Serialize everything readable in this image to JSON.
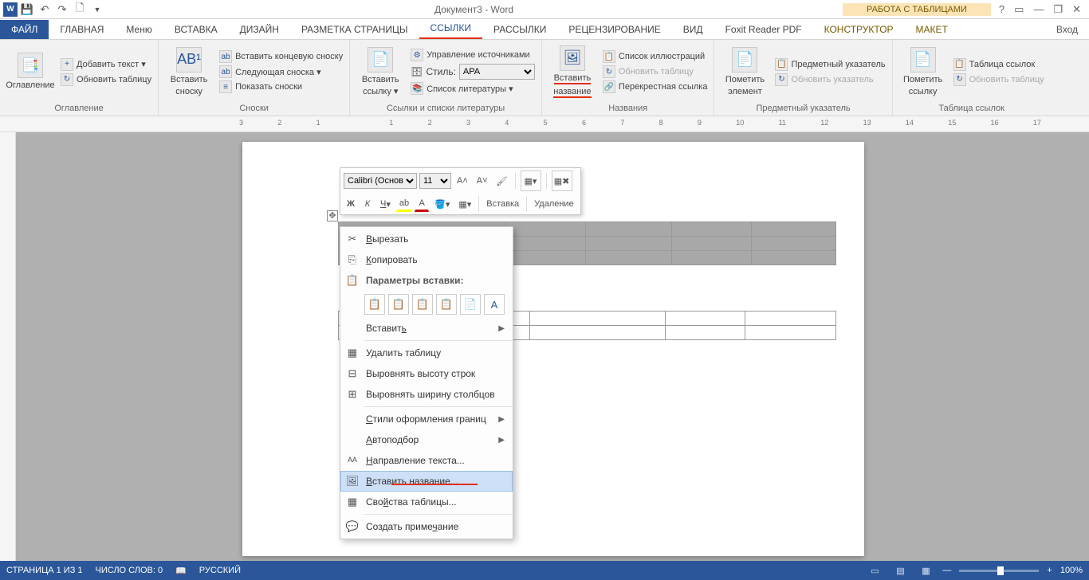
{
  "title": "Документ3 - Word",
  "tabletools": "РАБОТА С ТАБЛИЦАМИ",
  "winbtns": {
    "help": "?",
    "opts": "▭",
    "min": "—",
    "max": "❐",
    "close": "✕"
  },
  "tabs": {
    "file": "ФАЙЛ",
    "home": "ГЛАВНАЯ",
    "menu": "Меню",
    "insert": "ВСТАВКА",
    "design": "ДИЗАЙН",
    "layout": "РАЗМЕТКА СТРАНИЦЫ",
    "refs": "ССЫЛКИ",
    "mail": "РАССЫЛКИ",
    "review": "РЕЦЕНЗИРОВАНИЕ",
    "view": "ВИД",
    "foxit": "Foxit Reader PDF",
    "construct": "КОНСТРУКТОР",
    "maket": "МАКЕТ",
    "signin": "Вход"
  },
  "ribbon": {
    "toc": {
      "btn": "Оглавление",
      "add": "Добавить текст ▾",
      "upd": "Обновить таблицу",
      "label": "Оглавление"
    },
    "fn": {
      "btn1": "Вставить",
      "btn2": "сноску",
      "end": "Вставить концевую сноску",
      "next": "Следующая сноска ▾",
      "show": "Показать сноски",
      "label": "Сноски"
    },
    "cite": {
      "btn1": "Вставить",
      "btn2": "ссылку ▾",
      "src": "Управление источниками",
      "stylelbl": "Стиль:",
      "style": "APA",
      "bib": "Список литературы ▾",
      "label": "Ссылки и списки литературы"
    },
    "cap": {
      "btn1": "Вставить",
      "btn2": "название",
      "ill": "Список иллюстраций",
      "upd": "Обновить таблицу",
      "cross": "Перекрестная ссылка",
      "label": "Названия"
    },
    "idx": {
      "btn1": "Пометить",
      "btn2": "элемент",
      "pred": "Предметный указатель",
      "upd": "Обновить указатель",
      "label": "Предметный указатель"
    },
    "toa": {
      "btn1": "Пометить",
      "btn2": "ссылку",
      "tbl": "Таблица ссылок",
      "upd": "Обновить таблицу",
      "label": "Таблица ссылок"
    }
  },
  "ruler": [
    "3",
    "2",
    "1",
    "",
    "1",
    "2",
    "3",
    "4",
    "5",
    "6",
    "7",
    "8",
    "9",
    "10",
    "11",
    "12",
    "13",
    "14",
    "15",
    "16",
    "17"
  ],
  "mini": {
    "font": "Calibri (Основ",
    "size": "11",
    "insert": "Вставка",
    "delete": "Удаление",
    "b": "Ж",
    "i": "К"
  },
  "ctx": {
    "cut": "Вырезать",
    "copy": "Копировать",
    "pastehdr": "Параметры вставки:",
    "paste": "Вставить",
    "deltbl": "Удалить таблицу",
    "rowh": "Выровнять высоту строк",
    "colw": "Выровнять ширину столбцов",
    "bstyles": "Стили оформления границ",
    "autofit": "Автоподбор",
    "dir": "Направление текста...",
    "caption": "Вставить название...",
    "props": "Свойства таблицы...",
    "comment": "Создать примечание"
  },
  "status": {
    "page": "СТРАНИЦА 1 ИЗ 1",
    "words": "ЧИСЛО СЛОВ: 0",
    "lang": "РУССКИЙ",
    "zoom": "100%"
  }
}
